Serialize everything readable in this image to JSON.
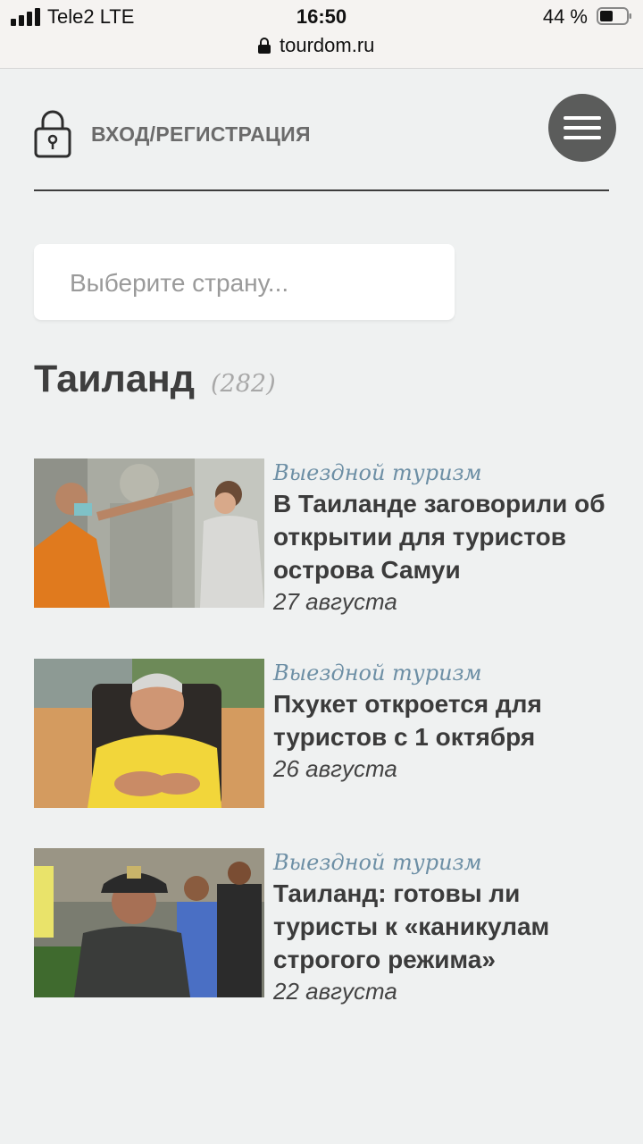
{
  "status_bar": {
    "carrier": "Tele2   LTE",
    "time": "16:50",
    "battery": "44 %",
    "url": "tourdom.ru"
  },
  "header": {
    "login_label": "ВХОД/РЕГИСТРАЦИЯ",
    "icons": [
      "lock-icon",
      "menu-icon"
    ]
  },
  "country_select": {
    "placeholder": "Выберите страну..."
  },
  "section": {
    "title": "Таиланд",
    "count": "(282)"
  },
  "articles": [
    {
      "category": "Выездной туризм",
      "title": "В Таиланде заговорили об открытии для туристов острова Самуи",
      "date": "27 августа"
    },
    {
      "category": "Выездной туризм",
      "title": "Пхукет откроется для туристов с 1 октября",
      "date": "26 августа"
    },
    {
      "category": "Выездной туризм",
      "title": "Таиланд: готовы ли туристы к «каникулам строгого режима»",
      "date": "22 августа"
    }
  ],
  "colors": {
    "background": "#eff1f1",
    "category": "#6d8fa5",
    "menu_button": "#5b5c5b"
  }
}
